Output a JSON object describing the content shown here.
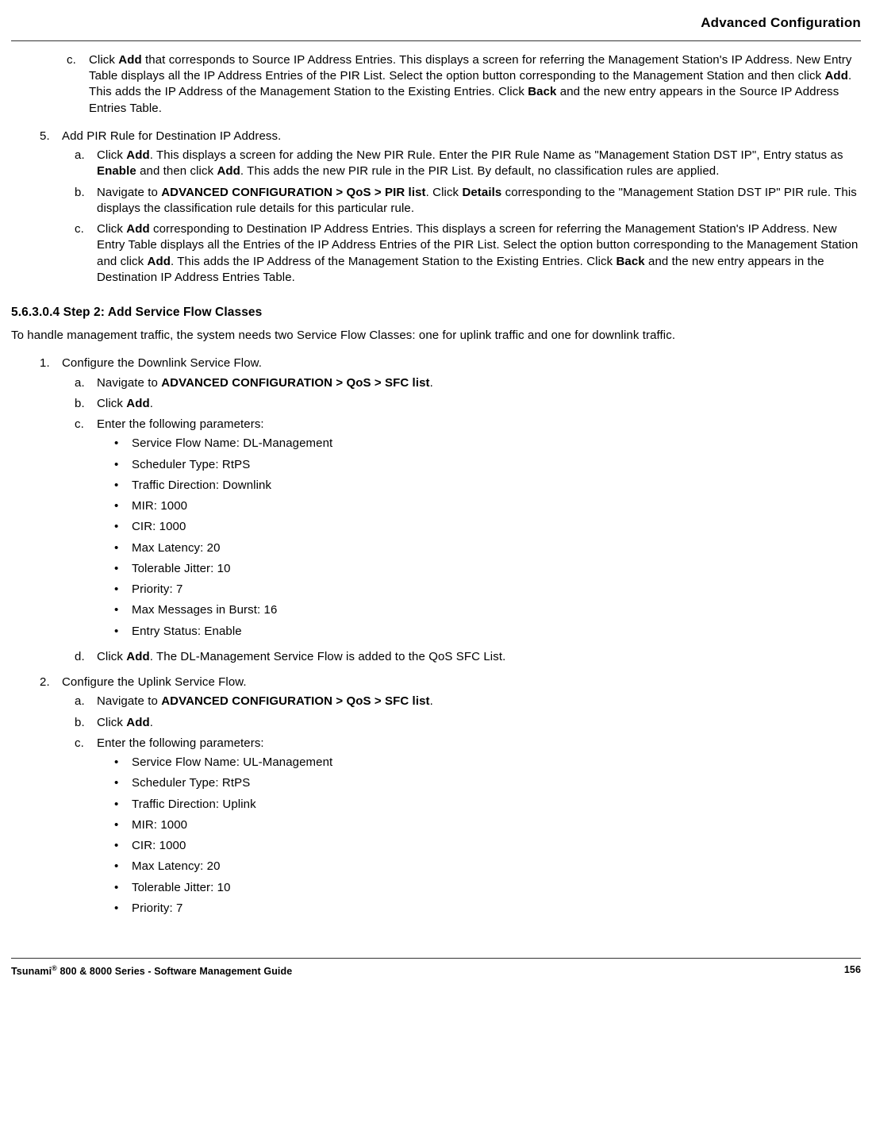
{
  "header": {
    "title": "Advanced Configuration"
  },
  "pre_steps": {
    "step_c": {
      "marker": "c.",
      "text_1": "Click ",
      "add": "Add",
      "text_2": " that corresponds to Source IP Address Entries. This displays a screen for referring the Management Station's IP Address. New Entry Table displays all the IP Address Entries of the PIR List. Select the option button corresponding to the Management Station and then click ",
      "add2": "Add",
      "text_3": ". This adds the IP Address of the Management Station to the Existing Entries. Click ",
      "back": "Back",
      "text_4": " and the new entry appears in the Source IP Address Entries Table."
    },
    "step5": {
      "marker": "5.",
      "text": "Add PIR Rule for Destination IP Address.",
      "a": {
        "marker": "a.",
        "t1": "Click ",
        "add": "Add",
        "t2": ". This displays a screen for adding the New PIR Rule. Enter the PIR Rule Name as \"Management Station DST IP\", Entry status as ",
        "enable": "Enable",
        "t3": " and then click ",
        "add2": "Add",
        "t4": ". This adds the new PIR rule in the PIR List. By default, no classification rules are applied."
      },
      "b": {
        "marker": "b.",
        "t1": "Navigate to ",
        "path": "ADVANCED CONFIGURATION > QoS > PIR list",
        "t2": ". Click ",
        "details": "Details",
        "t3": " corresponding to the \"Management Station DST IP\" PIR rule. This displays the classification rule details for this particular rule."
      },
      "c": {
        "marker": "c.",
        "t1": "Click ",
        "add": "Add",
        "t2": " corresponding to Destination IP Address Entries. This displays a screen for referring the Management Station's IP Address. New Entry Table displays all the Entries of the IP Address Entries of the PIR List. Select the option button corresponding to the Management Station and click ",
        "add2": "Add",
        "t3": ". This adds the IP Address of the Management Station to the Existing Entries. Click ",
        "back": "Back",
        "t4": " and the new entry appears in the Destination IP Address Entries Table."
      }
    }
  },
  "section2": {
    "title": "5.6.3.0.4 Step 2: Add Service Flow Classes",
    "intro": "To handle management traffic, the system needs two Service Flow Classes: one for uplink traffic and one for downlink traffic.",
    "step1": {
      "marker": "1.",
      "text": "Configure the Downlink Service Flow.",
      "a": {
        "marker": "a.",
        "t1": "Navigate to ",
        "path": "ADVANCED CONFIGURATION > QoS > SFC list",
        "t2": "."
      },
      "b": {
        "marker": "b.",
        "t1": "Click ",
        "add": "Add",
        "t2": "."
      },
      "c": {
        "marker": "c.",
        "text": "Enter the following parameters:"
      },
      "params": [
        "Service Flow Name: DL-Management",
        "Scheduler Type: RtPS",
        "Traffic Direction: Downlink",
        "MIR: 1000",
        "CIR: 1000",
        "Max Latency: 20",
        "Tolerable Jitter: 10",
        "Priority: 7",
        "Max Messages in Burst: 16",
        "Entry Status: Enable"
      ],
      "d": {
        "marker": "d.",
        "t1": " Click ",
        "add": "Add",
        "t2": ". The DL-Management Service Flow is added to the QoS SFC List."
      }
    },
    "step2": {
      "marker": "2.",
      "text": "Configure the Uplink Service Flow.",
      "a": {
        "marker": "a.",
        "t1": "Navigate to ",
        "path": "ADVANCED CONFIGURATION > QoS > SFC list",
        "t2": "."
      },
      "b": {
        "marker": "b.",
        "t1": "Click ",
        "add": "Add",
        "t2": "."
      },
      "c": {
        "marker": "c.",
        "text": "Enter the following parameters:"
      },
      "params": [
        "Service Flow Name: UL-Management",
        "Scheduler Type: RtPS",
        "Traffic Direction: Uplink",
        "MIR: 1000",
        "CIR: 1000",
        "Max Latency: 20",
        "Tolerable Jitter: 10",
        "Priority: 7"
      ]
    }
  },
  "footer": {
    "left1": "Tsunami",
    "left2": " 800 & 8000 Series - Software Management Guide",
    "page": "156"
  }
}
